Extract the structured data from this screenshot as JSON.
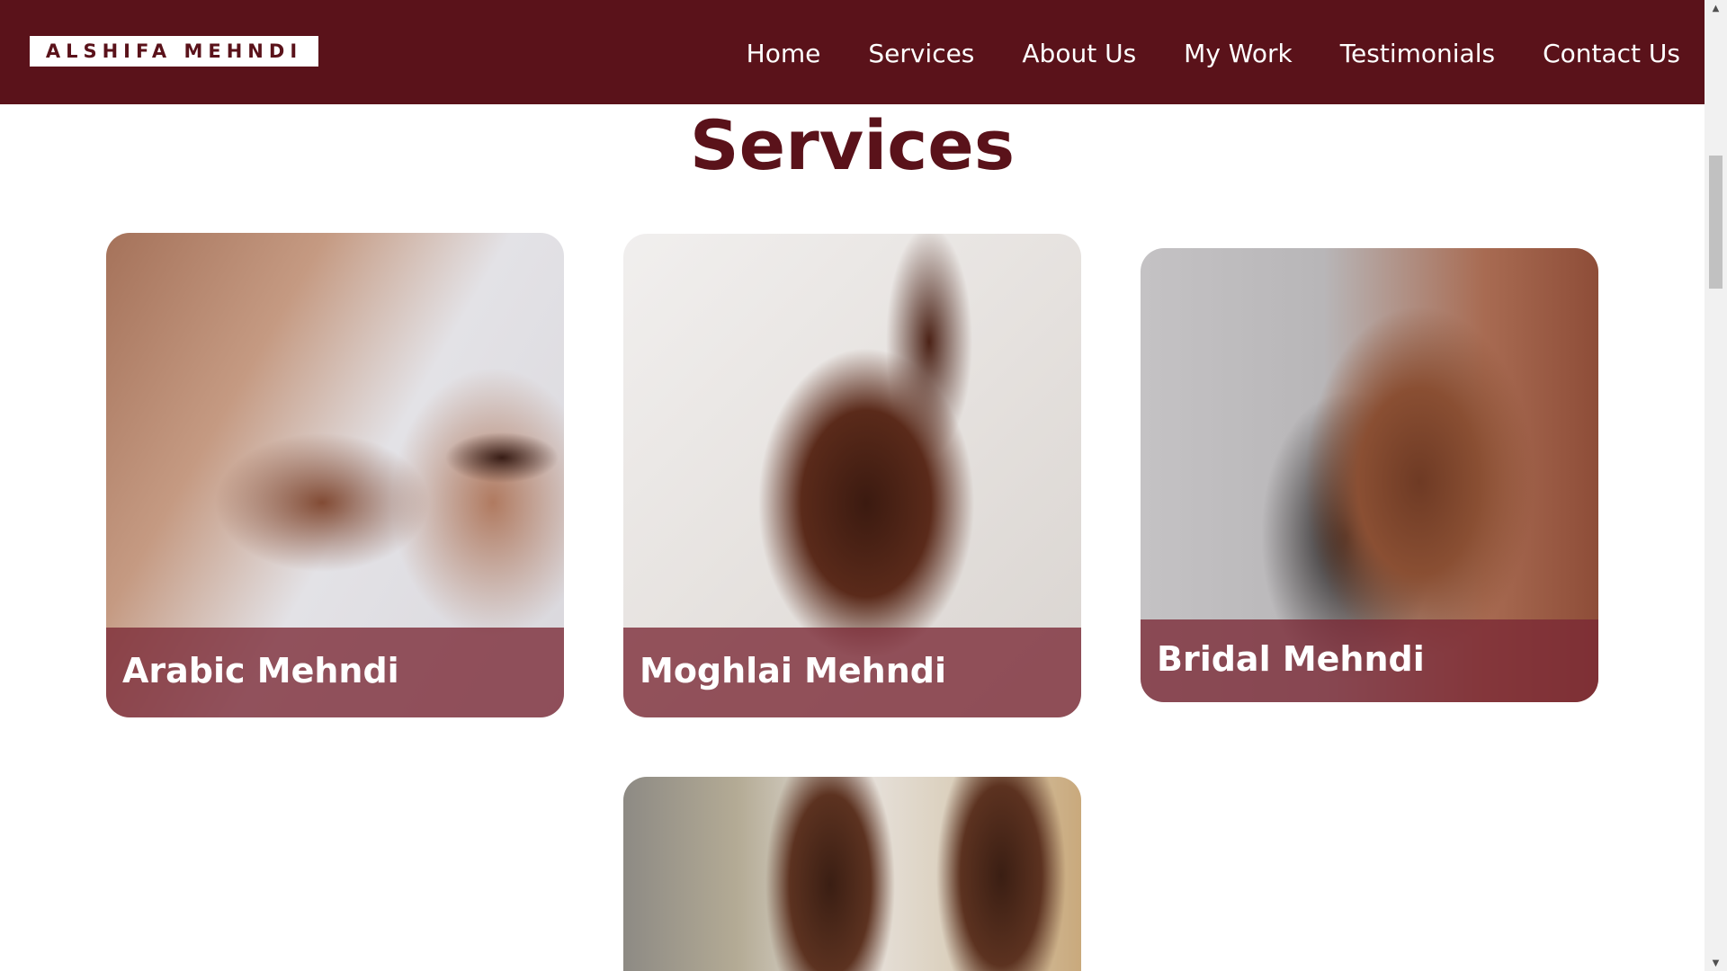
{
  "header": {
    "logo_text": "ALSHIFA MEHNDI",
    "nav": [
      "Home",
      "Services",
      "About Us",
      "My Work",
      "Testimonials",
      "Contact Us"
    ]
  },
  "services": {
    "title": "Services",
    "cards": [
      {
        "caption": "Arabic Mehndi"
      },
      {
        "caption": "Moghlai Mehndi"
      },
      {
        "caption": "Bridal Mehndi"
      },
      {
        "caption": ""
      }
    ]
  },
  "colors": {
    "brand": "#5a121a",
    "caption_overlay": "#7a2834",
    "background": "#ffffff"
  },
  "icons": {
    "scroll_up": "triangle-up-icon",
    "scroll_down": "triangle-down-icon"
  }
}
